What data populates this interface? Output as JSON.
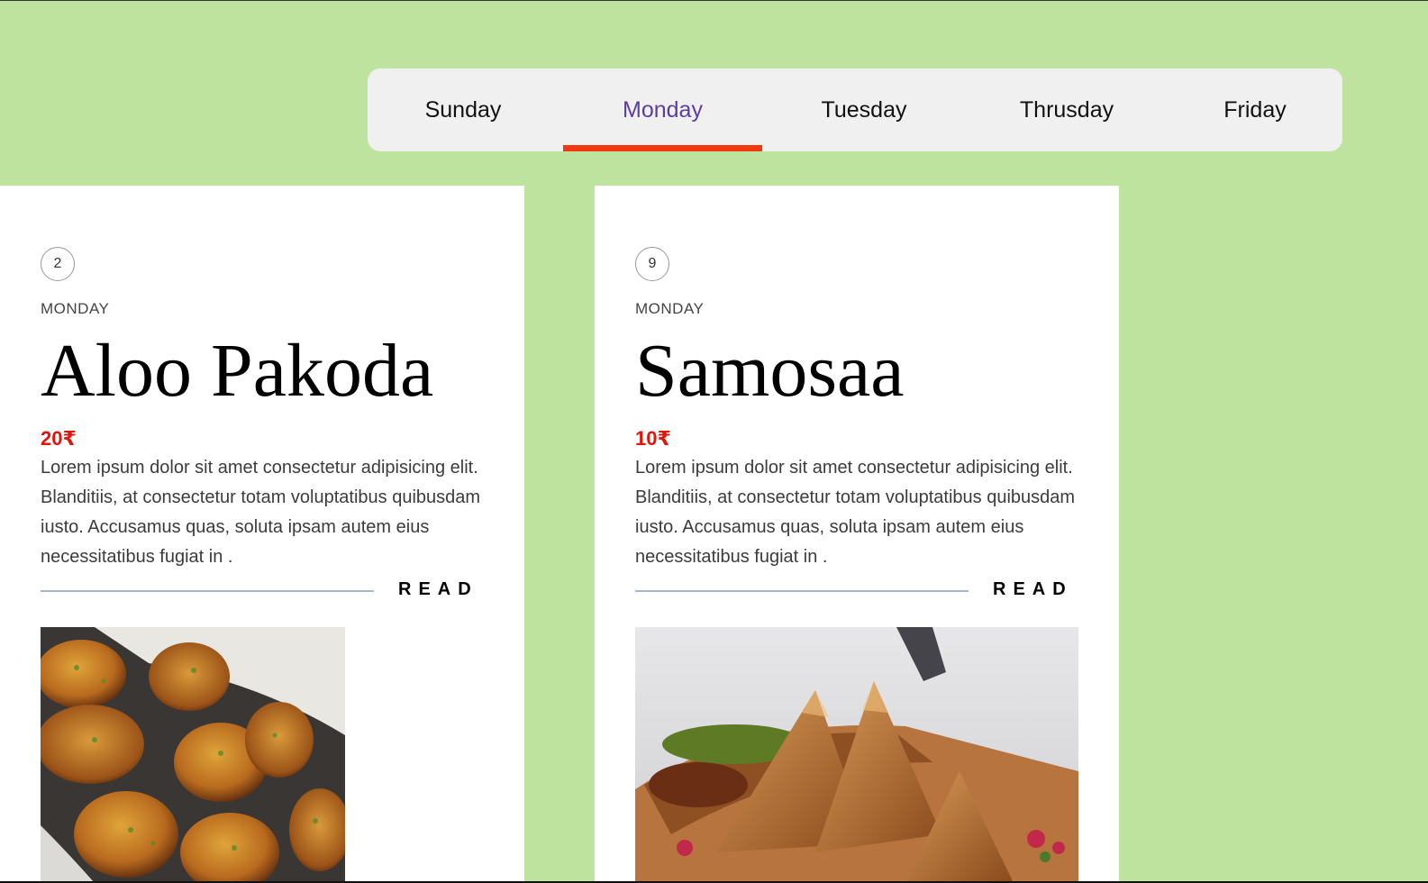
{
  "tabs": [
    {
      "label": "Sunday",
      "active": false
    },
    {
      "label": "Monday",
      "active": true
    },
    {
      "label": "Tuesday",
      "active": false
    },
    {
      "label": "Thrusday",
      "active": false
    },
    {
      "label": "Friday",
      "active": false
    }
  ],
  "cards": [
    {
      "number": "2",
      "day": "MONDAY",
      "title": "Aloo Pakoda",
      "price": "20₹",
      "description": "Lorem ipsum dolor sit amet consectetur adipisicing elit. Blanditiis, at consectetur totam voluptatibus quibusdam iusto. Accusamus quas, soluta ipsam autem eius necessitatibus fugiat in .",
      "read_label": "READ",
      "image": "aloo-pakoda-photo"
    },
    {
      "number": "9",
      "day": "MONDAY",
      "title": "Samosaa",
      "price": "10₹",
      "description": "Lorem ipsum dolor sit amet consectetur adipisicing elit. Blanditiis, at consectetur totam voluptatibus quibusdam iusto. Accusamus quas, soluta ipsam autem eius necessitatibus fugiat in .",
      "read_label": "READ",
      "image": "samosa-photo"
    }
  ],
  "colors": {
    "background": "#bee39e",
    "active_tab_text": "#5b3fa0",
    "active_tab_underline": "#f2380f",
    "price": "#e0160d"
  }
}
